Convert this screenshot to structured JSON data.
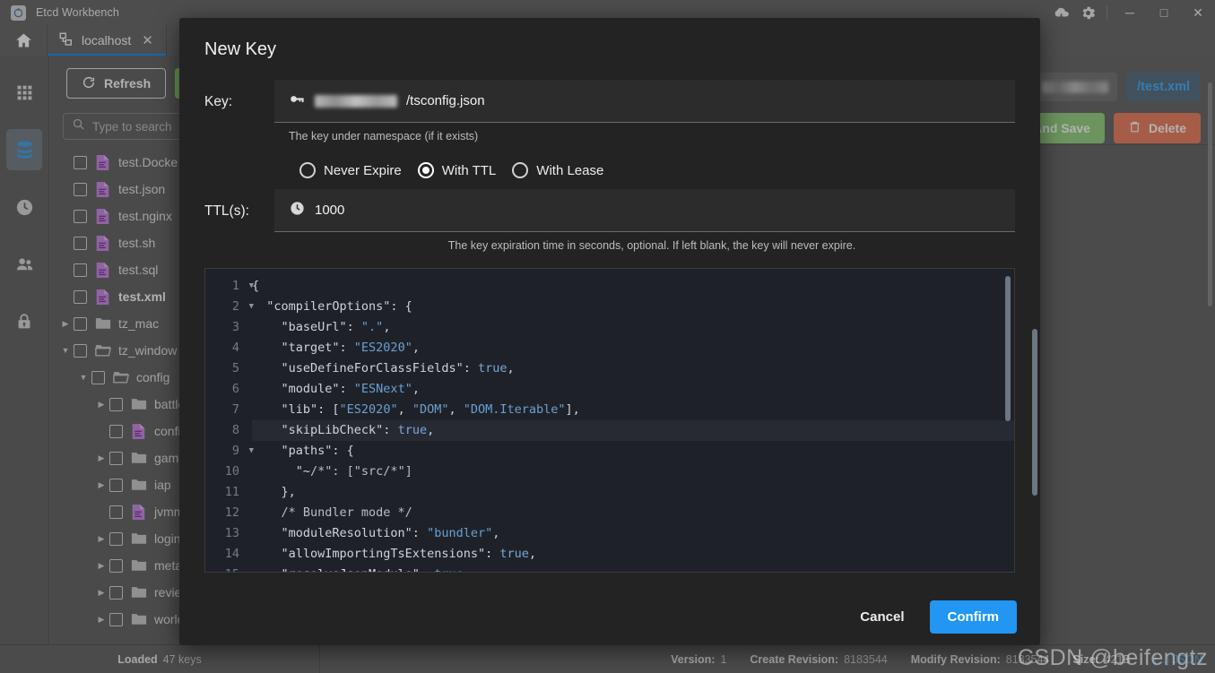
{
  "window": {
    "app_title": "Etcd Workbench",
    "logo_icon": "etcd-logo-icon",
    "cloud_icon": "cloud-download-icon",
    "gear_icon": "gear-icon",
    "minimize_label": "─",
    "maximize_label": "□",
    "close_label": "✕"
  },
  "tabs": {
    "home_icon": "home-icon",
    "items": [
      {
        "label": "localhost",
        "icon": "server-icon",
        "close": "✕",
        "active": true
      }
    ]
  },
  "rail": {
    "items": [
      {
        "name": "apps",
        "icon": "grid-apps-icon",
        "active": false
      },
      {
        "name": "keys",
        "icon": "database-icon",
        "active": true
      },
      {
        "name": "leases",
        "icon": "clock-icon",
        "active": false
      },
      {
        "name": "users",
        "icon": "users-icon",
        "active": false
      },
      {
        "name": "roles",
        "icon": "lock-icon",
        "active": false
      }
    ]
  },
  "left_panel": {
    "refresh_label": "Refresh",
    "refresh_icon": "refresh-icon",
    "search_placeholder": "Type to search",
    "search_icon": "search-icon",
    "search_value": "",
    "tree": [
      {
        "label": "test.Docke",
        "type": "file",
        "indent": 0,
        "expandable": false,
        "expanded": false,
        "bold": false
      },
      {
        "label": "test.json",
        "type": "file",
        "indent": 0,
        "expandable": false,
        "expanded": false,
        "bold": false
      },
      {
        "label": "test.nginx",
        "type": "file",
        "indent": 0,
        "expandable": false,
        "expanded": false,
        "bold": false
      },
      {
        "label": "test.sh",
        "type": "file",
        "indent": 0,
        "expandable": false,
        "expanded": false,
        "bold": false
      },
      {
        "label": "test.sql",
        "type": "file",
        "indent": 0,
        "expandable": false,
        "expanded": false,
        "bold": false
      },
      {
        "label": "test.xml",
        "type": "file",
        "indent": 0,
        "expandable": false,
        "expanded": false,
        "bold": true
      },
      {
        "label": "tz_mac",
        "type": "folder",
        "indent": 0,
        "expandable": true,
        "expanded": false,
        "bold": false
      },
      {
        "label": "tz_window",
        "type": "folder-open",
        "indent": 0,
        "expandable": true,
        "expanded": true,
        "bold": false
      },
      {
        "label": "config",
        "type": "folder-open",
        "indent": 1,
        "expandable": true,
        "expanded": true,
        "bold": false
      },
      {
        "label": "battle",
        "type": "folder",
        "indent": 2,
        "expandable": true,
        "expanded": false,
        "bold": false
      },
      {
        "label": "confi",
        "type": "file",
        "indent": 2,
        "expandable": false,
        "expanded": false,
        "bold": false
      },
      {
        "label": "game",
        "type": "folder",
        "indent": 2,
        "expandable": true,
        "expanded": false,
        "bold": false
      },
      {
        "label": "iap",
        "type": "folder",
        "indent": 2,
        "expandable": true,
        "expanded": false,
        "bold": false
      },
      {
        "label": "jvmm",
        "type": "file",
        "indent": 2,
        "expandable": false,
        "expanded": false,
        "bold": false
      },
      {
        "label": "login",
        "type": "folder",
        "indent": 2,
        "expandable": true,
        "expanded": false,
        "bold": false
      },
      {
        "label": "meta",
        "type": "folder",
        "indent": 2,
        "expandable": true,
        "expanded": false,
        "bold": false
      },
      {
        "label": "review",
        "type": "folder",
        "indent": 2,
        "expandable": true,
        "expanded": false,
        "bold": false
      },
      {
        "label": "world",
        "type": "folder",
        "indent": 2,
        "expandable": true,
        "expanded": false,
        "bold": false
      }
    ]
  },
  "main": {
    "namespace_chip_icon": "list-icon",
    "namespace_chip_value": "",
    "key_chip_label": "/test.xml",
    "save_label": "Copy And Save",
    "delete_label": "Delete",
    "delete_icon": "trash-icon"
  },
  "status": {
    "loaded_label": "Loaded",
    "loaded_value": "47 keys",
    "items": [
      {
        "key": "Version:",
        "value": "1"
      },
      {
        "key": "Create Revision:",
        "value": "8183544"
      },
      {
        "key": "Modify Revision:",
        "value": "8183544"
      },
      {
        "key": "Size:",
        "value": "421B"
      }
    ],
    "link_label": "[...] JSON"
  },
  "dialog": {
    "title": "New Key",
    "key_label": "Key:",
    "key_icon": "key-icon",
    "key_value": "/tsconfig.json",
    "key_hint": "The key under namespace (if it exists)",
    "expire_options": [
      {
        "label": "Never Expire",
        "selected": false
      },
      {
        "label": "With TTL",
        "selected": true
      },
      {
        "label": "With Lease",
        "selected": false
      }
    ],
    "ttl_label": "TTL(s):",
    "ttl_icon": "clock-icon",
    "ttl_value": "1000",
    "ttl_hint": "The key expiration time in seconds, optional. If left blank, the key will never expire.",
    "cancel_label": "Cancel",
    "confirm_label": "Confirm",
    "editor": {
      "lines": [
        {
          "n": "1",
          "fold": "v",
          "text": "{",
          "active": false
        },
        {
          "n": "2",
          "fold": "v",
          "text": "  \"compilerOptions\": {",
          "active": false
        },
        {
          "n": "3",
          "fold": "",
          "text": "    \"baseUrl\": \".\",",
          "active": false
        },
        {
          "n": "4",
          "fold": "",
          "text": "    \"target\": \"ES2020\",",
          "active": false
        },
        {
          "n": "5",
          "fold": "",
          "text": "    \"useDefineForClassFields\": true,",
          "active": false
        },
        {
          "n": "6",
          "fold": "",
          "text": "    \"module\": \"ESNext\",",
          "active": false
        },
        {
          "n": "7",
          "fold": "",
          "text": "    \"lib\": [\"ES2020\", \"DOM\", \"DOM.Iterable\"],",
          "active": false
        },
        {
          "n": "8",
          "fold": "",
          "text": "    \"skipLibCheck\": true,",
          "active": true
        },
        {
          "n": "9",
          "fold": "v",
          "text": "    \"paths\": {",
          "active": false
        },
        {
          "n": "10",
          "fold": "",
          "text": "      \"~/*\": [\"src/*\"]",
          "active": false
        },
        {
          "n": "11",
          "fold": "",
          "text": "    },",
          "active": false
        },
        {
          "n": "12",
          "fold": "",
          "text": "    /* Bundler mode */",
          "active": false
        },
        {
          "n": "13",
          "fold": "",
          "text": "    \"moduleResolution\": \"bundler\",",
          "active": false
        },
        {
          "n": "14",
          "fold": "",
          "text": "    \"allowImportingTsExtensions\": true,",
          "active": false
        },
        {
          "n": "15",
          "fold": "",
          "text": "    \"resolveJsonModule\": true,",
          "active": false
        }
      ]
    }
  },
  "watermark": "CSDN @beifengtz",
  "colors": {
    "accent_blue": "#2196f3",
    "save_green": "#9ad587",
    "delete_orange": "#f08566",
    "dialog_bg": "#232323",
    "editor_bg": "#1e2228",
    "chrome_gray": "#6e6e6e"
  }
}
